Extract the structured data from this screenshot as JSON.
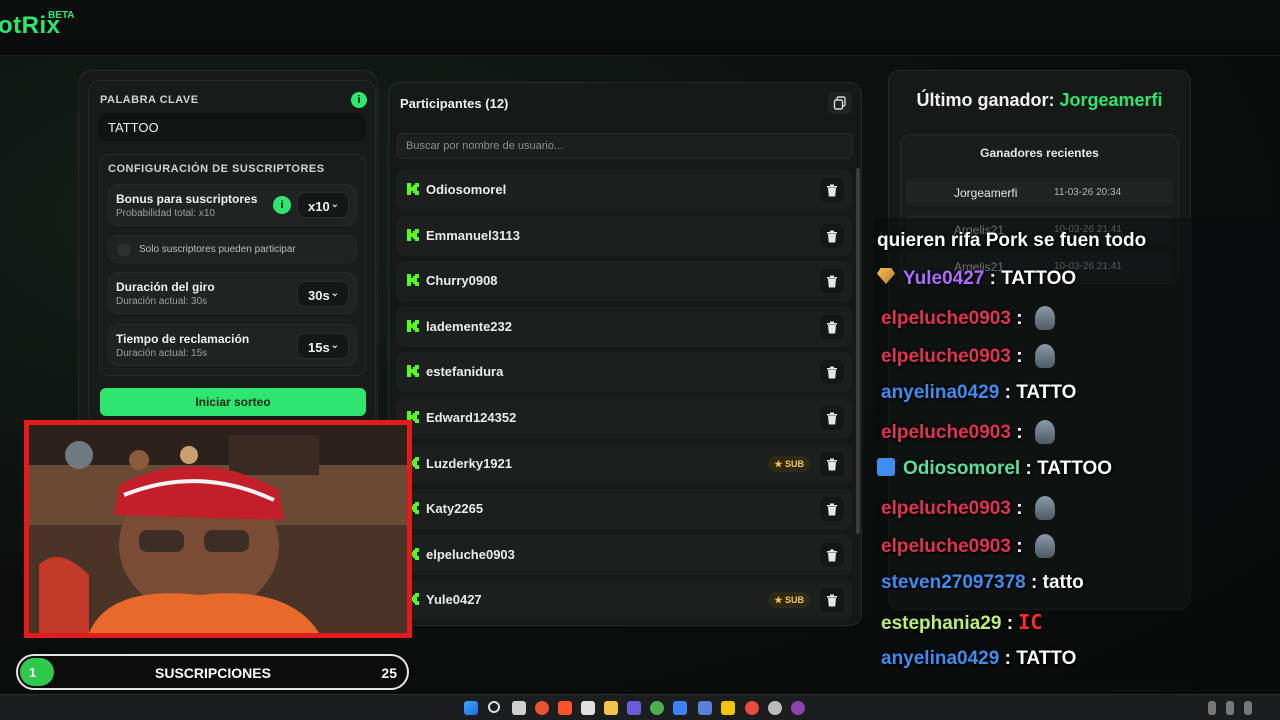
{
  "app": {
    "logo": "otRix",
    "beta": "BETA"
  },
  "config": {
    "keyword_label": "PALABRA CLAVE",
    "keyword_value": "TATTOO",
    "subs_section_label": "CONFIGURACIÓN DE SUSCRIPTORES",
    "bonus_title": "Bonus para suscriptores",
    "bonus_sub": "Probabilidad total: x10",
    "bonus_value": "x10",
    "only_subs_label": "Solo suscriptores pueden participar",
    "spin_title": "Duración del giro",
    "spin_sub": "Duración actual: 30s",
    "spin_value": "30s",
    "claim_title": "Tiempo de reclamación",
    "claim_sub": "Duración actual: 15s",
    "claim_value": "15s",
    "start_button": "Iniciar sorteo"
  },
  "participants": {
    "title": "Participantes (12)",
    "search_placeholder": "Buscar por nombre de usuario...",
    "sub_badge": "SUB",
    "items": [
      {
        "name": "Odiosomorel",
        "sub": false
      },
      {
        "name": "Emmanuel3113",
        "sub": false
      },
      {
        "name": "Churry0908",
        "sub": false
      },
      {
        "name": "lademente232",
        "sub": false
      },
      {
        "name": "estefanidura",
        "sub": false
      },
      {
        "name": "Edward124352",
        "sub": false
      },
      {
        "name": "Luzderky1921",
        "sub": true
      },
      {
        "name": "Katy2265",
        "sub": false
      },
      {
        "name": "elpeluche0903",
        "sub": false
      },
      {
        "name": "Yule0427",
        "sub": true
      }
    ]
  },
  "winners": {
    "last_label": "Último ganador:",
    "last_name": "Jorgeamerfi",
    "recent_title": "Ganadores recientes",
    "recent": [
      {
        "name": "Jorgeamerfi",
        "date": "11-03-26 20:34"
      },
      {
        "name": "Argelis21",
        "date": "10-03-26 21:41"
      },
      {
        "name": "Argelis21",
        "date": "10-03-26 21:41"
      }
    ]
  },
  "chat": {
    "lines": [
      {
        "user": "",
        "text": "quieren rifa Pork se fuen todo",
        "color": "#ffffff"
      },
      {
        "user": "Yule0427",
        "text": ": TATTOO",
        "color": "#b06cff",
        "badge": "gem"
      },
      {
        "user": "elpeluche0903",
        "text": ":",
        "color": "#e0334f",
        "emote": true
      },
      {
        "user": "elpeluche0903",
        "text": ":",
        "color": "#e0334f",
        "emote": true
      },
      {
        "user": "anyelina0429",
        "text": ": TATTO",
        "color": "#3d8ef0"
      },
      {
        "user": "elpeluche0903",
        "text": ":",
        "color": "#e0334f",
        "emote": true
      },
      {
        "user": "Odiosomorel",
        "text": ": TATTOO",
        "color": "#57e0a0",
        "badge": "hammer"
      },
      {
        "user": "elpeluche0903",
        "text": ":",
        "color": "#e0334f",
        "emote": true
      },
      {
        "user": "elpeluche0903",
        "text": ":",
        "color": "#e0334f",
        "emote": true
      },
      {
        "user": "steven27097378",
        "text": ": tatto",
        "color": "#3d8ef0"
      },
      {
        "user": "estephania29",
        "text": ":",
        "color": "#b7f07a",
        "emote_ic": "IC"
      },
      {
        "user": "anyelina0429",
        "text": ": TATTO",
        "color": "#3d8ef0"
      }
    ]
  },
  "overlay": {
    "subs_label": "SUSCRIPCIONES",
    "subs_count": "1",
    "subs_goal": "25"
  },
  "colors": {
    "accent": "#2ee56f",
    "frame": "#e21c1c"
  }
}
